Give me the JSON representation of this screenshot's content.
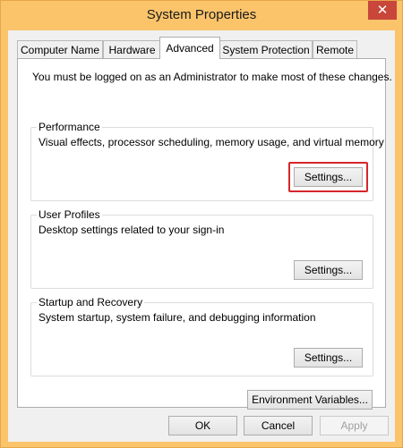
{
  "window": {
    "title": "System Properties",
    "close_symbol": "✕"
  },
  "tabs": [
    {
      "label": "Computer Name"
    },
    {
      "label": "Hardware"
    },
    {
      "label": "Advanced"
    },
    {
      "label": "System Protection"
    },
    {
      "label": "Remote"
    }
  ],
  "active_tab": "Advanced",
  "intro": "You must be logged on as an Administrator to make most of these changes.",
  "performance": {
    "title": "Performance",
    "description": "Visual effects, processor scheduling, memory usage, and virtual memory",
    "button": "Settings..."
  },
  "user_profiles": {
    "title": "User Profiles",
    "description": "Desktop settings related to your sign-in",
    "button": "Settings..."
  },
  "startup_recovery": {
    "title": "Startup and Recovery",
    "description": "System startup, system failure, and debugging information",
    "button": "Settings..."
  },
  "env_button": "Environment Variables...",
  "footer": {
    "ok": "OK",
    "cancel": "Cancel",
    "apply": "Apply"
  },
  "colors": {
    "frame": "#fbc46b",
    "close": "#c8463a",
    "highlight": "#d6262b"
  }
}
